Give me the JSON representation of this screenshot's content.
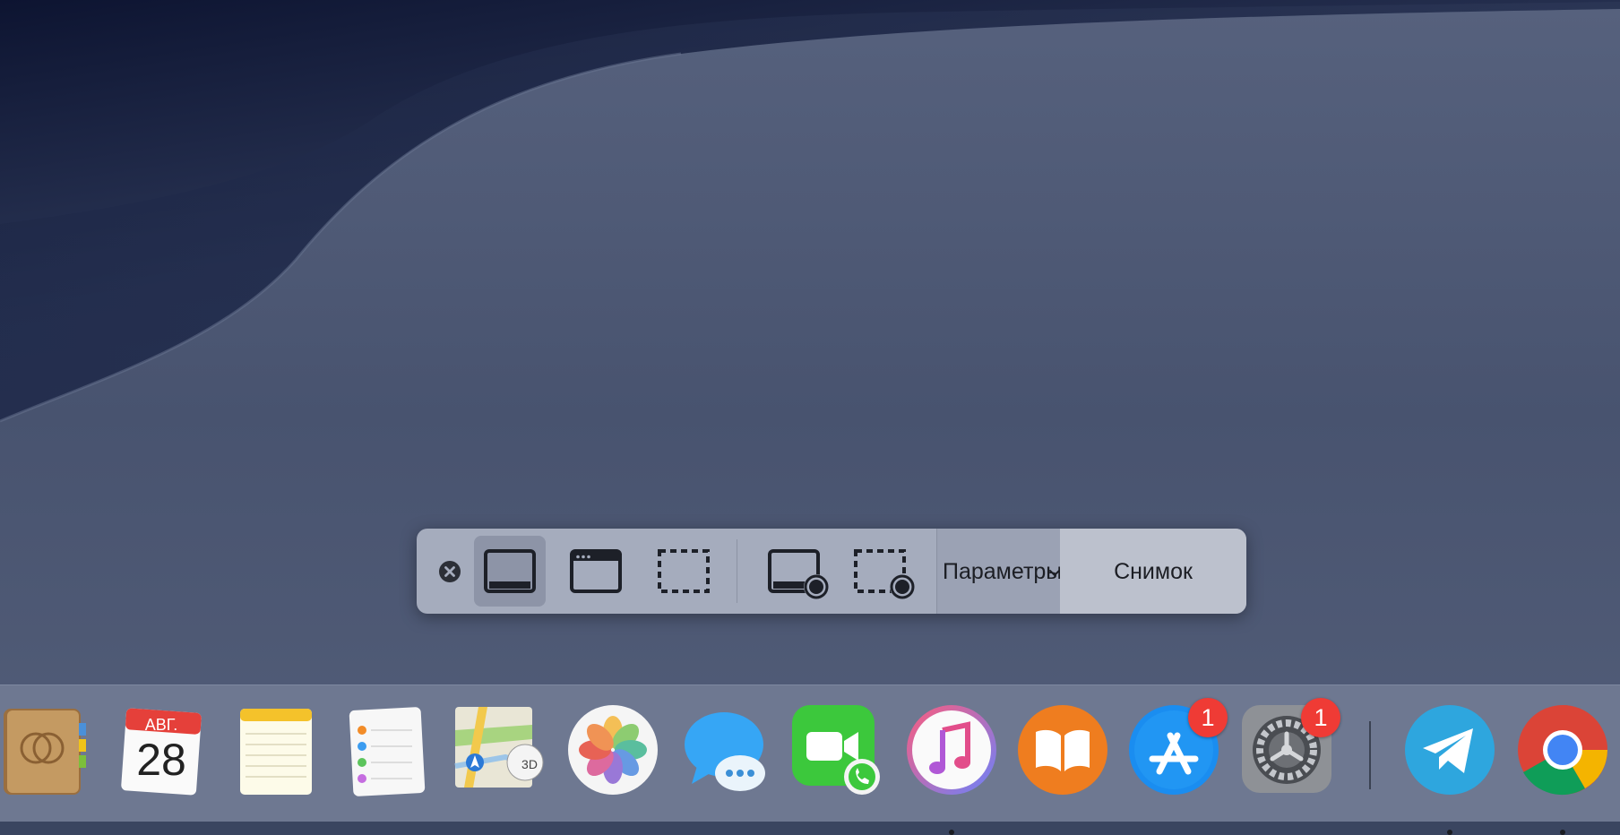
{
  "toolbar": {
    "buttons": [
      {
        "name": "close",
        "icon": "close-icon"
      },
      {
        "name": "capture-entire-screen",
        "icon": "entire-screen-icon",
        "selected": true
      },
      {
        "name": "capture-selected-window",
        "icon": "window-icon"
      },
      {
        "name": "capture-selected-portion",
        "icon": "dashed-selection-icon"
      },
      {
        "name": "record-entire-screen",
        "icon": "record-screen-icon"
      },
      {
        "name": "record-selected-portion",
        "icon": "record-selection-icon"
      }
    ],
    "options_label": "Параметры",
    "capture_label": "Снимок"
  },
  "dock": {
    "items": [
      {
        "app": "Contacts",
        "icon": "contacts-icon",
        "running": false
      },
      {
        "app": "Calendar",
        "icon": "calendar-icon",
        "month": "АВГ.",
        "day": "28",
        "running": false
      },
      {
        "app": "Notes",
        "icon": "notes-icon",
        "running": false
      },
      {
        "app": "Reminders",
        "icon": "reminders-icon",
        "running": false
      },
      {
        "app": "Maps",
        "icon": "maps-icon",
        "label": "3D",
        "running": false
      },
      {
        "app": "Photos",
        "icon": "photos-icon",
        "running": false
      },
      {
        "app": "Messages",
        "icon": "messages-icon",
        "running": false
      },
      {
        "app": "FaceTime",
        "icon": "facetime-icon",
        "running": false
      },
      {
        "app": "iTunes",
        "icon": "itunes-icon",
        "running": true
      },
      {
        "app": "Books",
        "icon": "books-icon",
        "running": false
      },
      {
        "app": "App Store",
        "icon": "app-store-icon",
        "badge": "1",
        "running": false
      },
      {
        "app": "System Preferences",
        "icon": "system-preferences-icon",
        "badge": "1",
        "running": false
      },
      {
        "app": "Telegram",
        "icon": "telegram-icon",
        "running": true
      },
      {
        "app": "Chrome",
        "icon": "chrome-icon",
        "running": true
      }
    ]
  },
  "colors": {
    "desktop_dark": "#0f1732",
    "desktop_mid": "#4b5672",
    "toolbar_bg": "#a5acbd",
    "dock_bg": "#6e7891",
    "badge_red": "#ef3b35"
  }
}
